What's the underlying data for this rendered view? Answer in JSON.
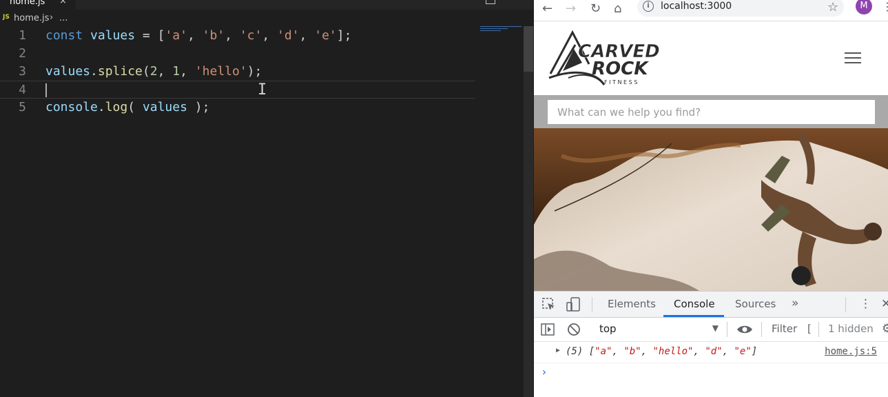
{
  "editor": {
    "tab": {
      "name": "home.js",
      "close": "×"
    },
    "breadcrumb": {
      "icon": "JS",
      "file": "home.js",
      "separator": "›",
      "rest": "..."
    },
    "lines": [
      {
        "number": "1",
        "tokens": [
          {
            "t": "const",
            "c": "kw"
          },
          {
            "t": " ",
            "c": ""
          },
          {
            "t": "values",
            "c": "var"
          },
          {
            "t": " = [",
            "c": ""
          },
          {
            "t": "'a'",
            "c": "str"
          },
          {
            "t": ", ",
            "c": ""
          },
          {
            "t": "'b'",
            "c": "str"
          },
          {
            "t": ", ",
            "c": ""
          },
          {
            "t": "'c'",
            "c": "str"
          },
          {
            "t": ", ",
            "c": ""
          },
          {
            "t": "'d'",
            "c": "str"
          },
          {
            "t": ", ",
            "c": ""
          },
          {
            "t": "'e'",
            "c": "str"
          },
          {
            "t": "];",
            "c": ""
          }
        ]
      },
      {
        "number": "2",
        "tokens": []
      },
      {
        "number": "3",
        "tokens": [
          {
            "t": "values",
            "c": "var"
          },
          {
            "t": ".",
            "c": ""
          },
          {
            "t": "splice",
            "c": "fn"
          },
          {
            "t": "(",
            "c": ""
          },
          {
            "t": "2",
            "c": "num"
          },
          {
            "t": ", ",
            "c": ""
          },
          {
            "t": "1",
            "c": "num"
          },
          {
            "t": ", ",
            "c": ""
          },
          {
            "t": "'hello'",
            "c": "str"
          },
          {
            "t": ");",
            "c": ""
          }
        ]
      },
      {
        "number": "4",
        "tokens": []
      },
      {
        "number": "5",
        "tokens": [
          {
            "t": "console",
            "c": "var"
          },
          {
            "t": ".",
            "c": ""
          },
          {
            "t": "log",
            "c": "fn"
          },
          {
            "t": "( ",
            "c": ""
          },
          {
            "t": "values",
            "c": "var"
          },
          {
            "t": " );",
            "c": ""
          }
        ]
      }
    ],
    "current_line": 4
  },
  "browser": {
    "url": "localhost:3000",
    "avatar_initial": "M",
    "search": {
      "placeholder": "What can we help you find?"
    },
    "logo": {
      "line1": "CARVED",
      "line2": "ROCK",
      "line3": "F I T N E S S"
    },
    "devtools": {
      "tabs": [
        "Elements",
        "Console",
        "Sources"
      ],
      "active_tab": "Console",
      "more": "»",
      "context": "top",
      "filter_label": "Filter",
      "hidden": "1 hidden",
      "log": {
        "prefix": "(5) [",
        "items": [
          "\"a\"",
          "\"b\"",
          "\"hello\"",
          "\"d\"",
          "\"e\""
        ],
        "suffix": "]",
        "source": "home.js:5"
      },
      "prompt": "›"
    }
  },
  "colors": {
    "accent": "#1a73e8",
    "editor_bg": "#1e1e1e"
  }
}
